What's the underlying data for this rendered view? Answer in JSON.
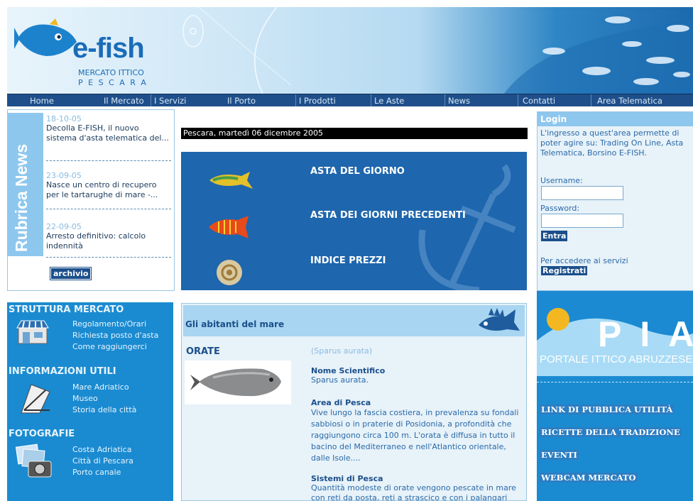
{
  "header": {
    "logo_text": "e-fish",
    "subtitle_line1": "MERCATO ITTICO",
    "subtitle_line2": "P E S C A R A"
  },
  "nav": {
    "items": [
      {
        "label": "Home"
      },
      {
        "label": "Il Mercato"
      },
      {
        "label": "I Servizi"
      },
      {
        "label": "Il Porto"
      },
      {
        "label": "I Prodotti"
      },
      {
        "label": "Le Aste"
      },
      {
        "label": "News"
      },
      {
        "label": "Contatti"
      },
      {
        "label": "Area Telematica"
      }
    ]
  },
  "news": {
    "side_title": "Rubrica News",
    "items": [
      {
        "date": "18-10-05",
        "text": "Decolla E-FISH, il nuovo sistema d'asta telematica del..."
      },
      {
        "date": "23-09-05",
        "text": "Nasce un centro di recupero per le tartarughe di mare -..."
      },
      {
        "date": "22-09-05",
        "text": "Arresto definitivo: calcolo indennità"
      }
    ],
    "archive_label": "archivio"
  },
  "date_bar": "Pescara, martedì 06 dicembre 2005",
  "auction": {
    "links": [
      {
        "label": "ASTA DEL GIORNO"
      },
      {
        "label": "ASTA DEI GIORNI PRECEDENTI"
      },
      {
        "label": "INDICE PREZZI"
      }
    ]
  },
  "login": {
    "title": "Login",
    "description": "L'ingresso a quest'area permette di poter agire su: Trading On Line, Asta Telematica, Borsino E-FISH.",
    "username_label": "Username:",
    "username_value": "",
    "password_label": "Password:",
    "password_value": "",
    "enter_label": "Entra",
    "register_text": "Per accedere ai servizi",
    "register_label": "Registrati"
  },
  "left_menu": {
    "sections": [
      {
        "title": "STRUTTURA MERCATO",
        "links": [
          "Regolamento/Orari",
          "Richiesta posto d'asta",
          "Come raggiungerci"
        ]
      },
      {
        "title": "INFORMAZIONI UTILI",
        "links": [
          "Mare Adriatico",
          "Museo",
          "Storia della città"
        ]
      },
      {
        "title": "FOTOGRAFIE",
        "links": [
          "Costa Adriatica",
          "Città di Pescara",
          "Porto canale"
        ]
      }
    ]
  },
  "sea": {
    "header_title": "Gli abitanti del mare",
    "fish_name": "ORATE",
    "latin_name": "(Sparus aurata)",
    "sections": [
      {
        "title": "Nome Scientifico",
        "text": "Sparus aurata."
      },
      {
        "title": "Area di Pesca",
        "text": "Vive lungo la fascia costiera, in prevalenza su fondali sabbiosi o in praterie di Posidonia, a profondità che raggiungono circa 100 m. L'orata è diffusa in tutto il bacino del Mediterraneo e nell'Atlantico orientale, dalle Isole...."
      },
      {
        "title": "Sistemi di Pesca",
        "text": "Quantità modeste di orate vengono pescate in mare con reti da posta, reti a strascico e con i palangari"
      }
    ]
  },
  "pia": {
    "logo_text": "PIA",
    "subtitle": "PORTALE ITTICO ABRUZZESE",
    "links": [
      {
        "label": "LINK DI PUBBLICA UTILITÀ"
      },
      {
        "label": "RICETTE DELLA TRADIZIONE"
      },
      {
        "label": "EVENTI"
      },
      {
        "label": "WEBCAM MERCATO"
      }
    ]
  },
  "colors": {
    "accent": "#1a8bd1",
    "nav": "#1f4f8a",
    "dark_blue": "#1b4f8b"
  }
}
